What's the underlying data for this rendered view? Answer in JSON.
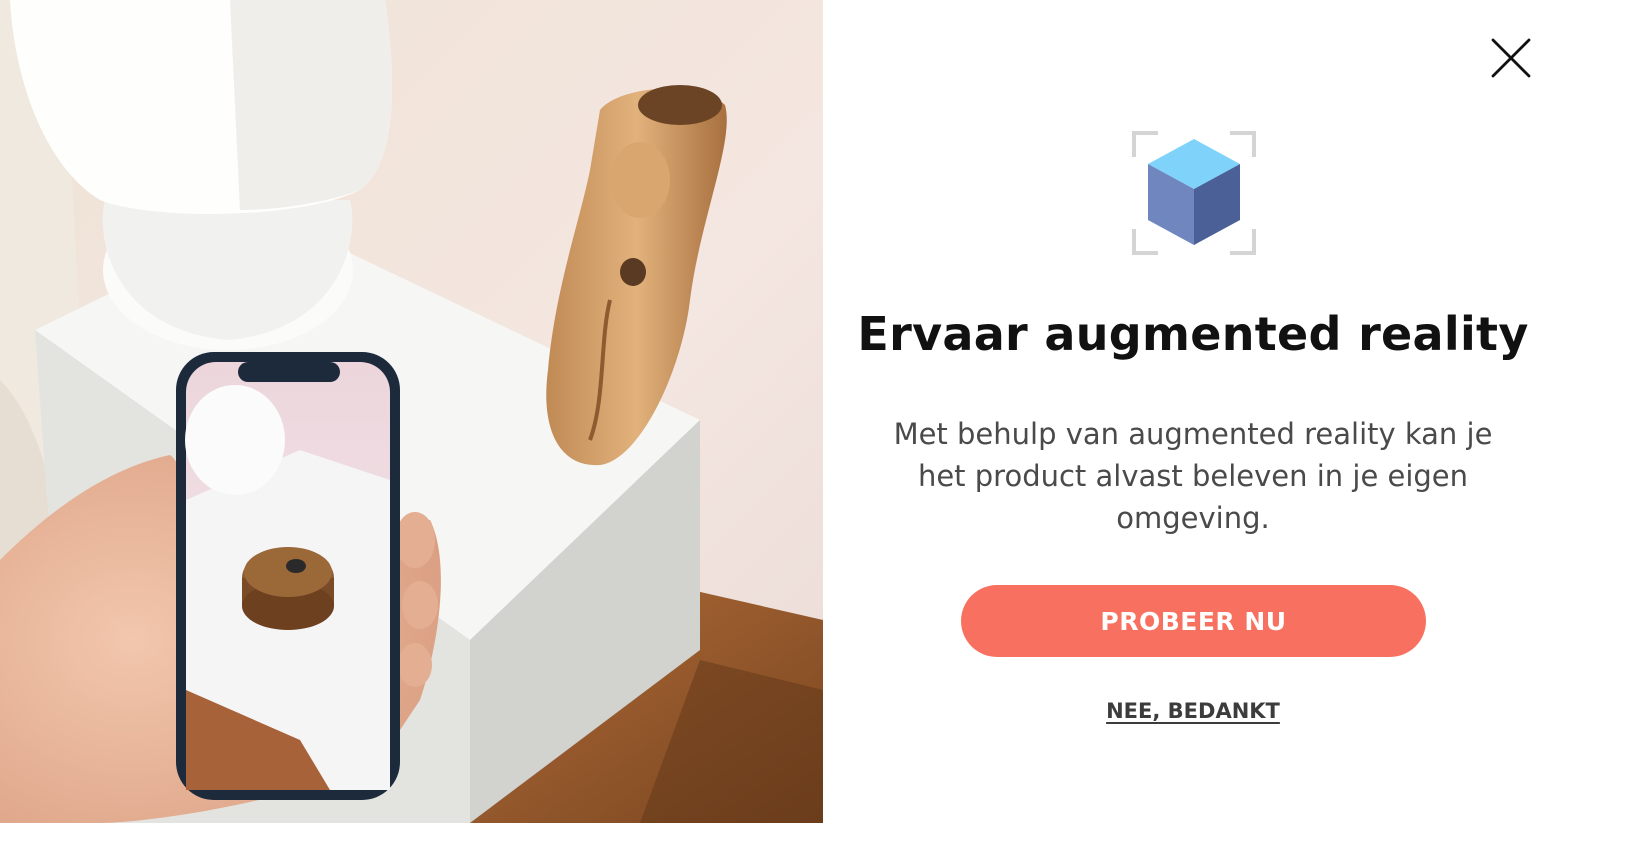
{
  "hero_image": {
    "icon": "ar-phone-photo"
  },
  "close_button": {
    "icon": "close-icon"
  },
  "ar_icon": {
    "icon": "ar-cube-icon",
    "colors": {
      "top": "#7fd3fb",
      "left": "#6f86bf",
      "right": "#4b6096",
      "frame": "#d4d4d4"
    }
  },
  "title": "Ervaar augmented reality",
  "description": "Met behulp van augmented reality kan je het product alvast beleven in je eigen omgeving.",
  "primary_button": {
    "label": "PROBEER NU",
    "color": "#f87160"
  },
  "secondary_link": {
    "label": "NEE, BEDANKT"
  }
}
